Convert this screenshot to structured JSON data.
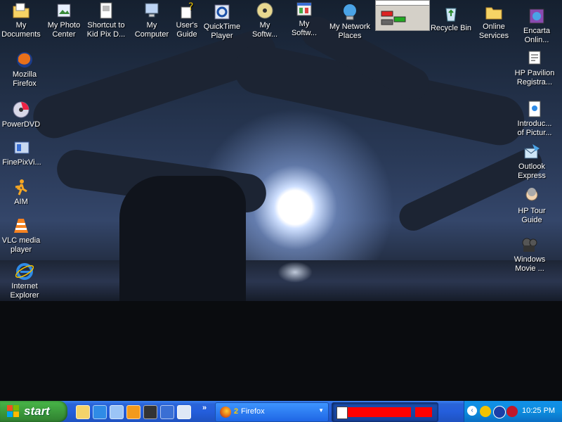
{
  "desktop": {
    "left_icons": [
      {
        "label": "My\nDocuments",
        "icon": "folder-documents-icon"
      },
      {
        "label": "Mozilla\nFirefox",
        "icon": "firefox-icon"
      },
      {
        "label": "PowerDVD",
        "icon": "dvd-icon"
      },
      {
        "label": "FinePixVi...",
        "icon": "camera-app-icon"
      },
      {
        "label": "AIM",
        "icon": "aim-runner-icon"
      },
      {
        "label": "VLC media\nplayer",
        "icon": "vlc-cone-icon"
      },
      {
        "label": "Internet\nExplorer",
        "icon": "internet-explorer-icon"
      }
    ],
    "top_icons": [
      {
        "label": "My Photo\nCenter",
        "icon": "photo-center-icon"
      },
      {
        "label": "Shortcut to\nKid Pix D...",
        "icon": "kidpix-icon"
      },
      {
        "label": "My\nComputer",
        "icon": "my-computer-icon"
      },
      {
        "label": "User's\nGuide",
        "icon": "users-guide-icon"
      },
      {
        "label": "QuickTime\nPlayer",
        "icon": "quicktime-icon"
      },
      {
        "label": "My\nSoftw...",
        "icon": "software-cd-icon"
      },
      {
        "label": "My\nSoftw...",
        "icon": "software-window-icon"
      },
      {
        "label": "My Network\nPlaces",
        "icon": "network-places-icon"
      },
      {
        "label": "Recycle Bin",
        "icon": "recycle-bin-icon"
      },
      {
        "label": "Online\nServices",
        "icon": "online-services-folder-icon"
      }
    ],
    "right_icons": [
      {
        "label": "Encarta\nOnlin...",
        "icon": "encarta-icon"
      },
      {
        "label": "HP Pavilion\nRegistra...",
        "icon": "hp-registration-icon"
      },
      {
        "label": "Introduc...\nof Pictur...",
        "icon": "intro-pictures-icon"
      },
      {
        "label": "Outlook\nExpress",
        "icon": "outlook-express-icon"
      },
      {
        "label": "HP Tour\nGuide",
        "icon": "hp-tour-guide-icon"
      },
      {
        "label": "Windows\nMovie ...",
        "icon": "windows-movie-maker-icon"
      }
    ]
  },
  "taskbar": {
    "start_label": "start",
    "quick_launch": [
      {
        "icon": "outlook-quicklaunch-icon",
        "color": "#f4d36a"
      },
      {
        "icon": "ie-quicklaunch-icon",
        "color": "#2f8be6"
      },
      {
        "icon": "show-desktop-icon",
        "color": "#9bc4f6"
      },
      {
        "icon": "media-player-icon",
        "color": "#f39a1c"
      },
      {
        "icon": "movie-icon",
        "color": "#333333"
      },
      {
        "icon": "help-icon",
        "color": "#3a6fd4"
      },
      {
        "icon": "search-window-icon",
        "color": "#dfe8f6"
      }
    ],
    "firefox_task": {
      "count": "2",
      "label": "Firefox"
    },
    "im_task": {
      "label": ""
    },
    "clock": "10:25 PM",
    "tray_icons": [
      "norton-shield-icon",
      "aim-tray-icon",
      "mcafee-shield-icon"
    ]
  }
}
